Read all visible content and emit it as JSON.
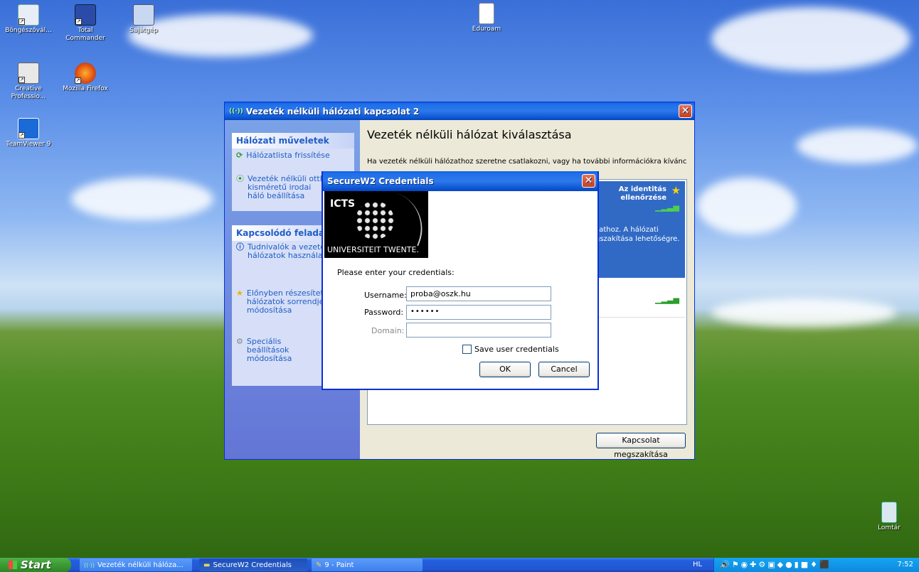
{
  "desktop_icons": [
    {
      "label": "Böngészővál..."
    },
    {
      "label": "Total Commander"
    },
    {
      "label": "Sajátgép"
    },
    {
      "label": "Eduroam"
    },
    {
      "label": "Creative Professio..."
    },
    {
      "label": "Mozilla Firefox"
    },
    {
      "label": "TeamViewer 9"
    },
    {
      "label": "Lomtár"
    }
  ],
  "wireless_window": {
    "title": "Vezeték nélküli hálózati kapcsolat 2",
    "heading": "Vezeték nélküli hálózat kiválasztása",
    "intro": "Ha vezeték nélküli hálózathoz szeretne csatlakozni, vagy ha további információkra kíváncsi,",
    "sidebar": {
      "section1_title": "Hálózati műveletek",
      "refresh": "Hálózatlista frissítése",
      "setup": "Vezeték nélküli otth kisméretű irodai háló beállítása",
      "section2_title": "Kapcsolódó feladatok",
      "learn": "Tudnivalók a vezeté hálózatok használat",
      "priority": "Előnyben részesítet hálózatok sorrendjé módosítása",
      "advanced": "Speciális beállítások módosítása"
    },
    "network": {
      "auth_status": "Az identitás ellenőrzése",
      "details": "zathoz. A hálózati gszakítása lehetőségre."
    },
    "disconnect_button": "Kapcsolat megszakítása"
  },
  "credentials_dialog": {
    "title": "SecureW2 Credentials",
    "logo_top": "ICTS",
    "logo_bottom": "UNIVERSITEIT TWENTE.",
    "prompt": "Please enter your credentials:",
    "username_label": "Username:",
    "username_value": "proba@oszk.hu",
    "password_label": "Password:",
    "password_value": "••••••",
    "domain_label": "Domain:",
    "domain_value": "",
    "save_label": "Save user credentials",
    "ok": "OK",
    "cancel": "Cancel"
  },
  "taskbar": {
    "start": "Start",
    "tasks": [
      "Vezeték nélküli hálóza...",
      "SecureW2 Credentials",
      "9 - Paint"
    ],
    "language": "HL",
    "clock": "7:52"
  }
}
